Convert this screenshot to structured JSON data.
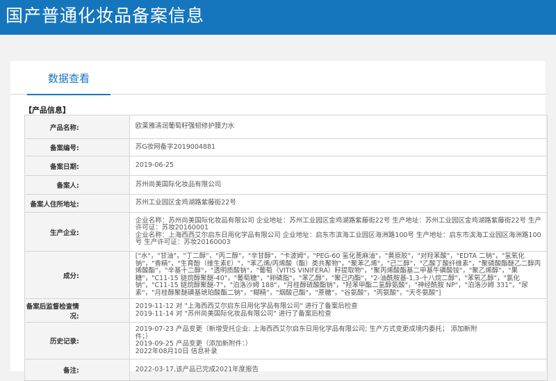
{
  "header": {
    "title": "国产普通化妆品备案信息"
  },
  "tabs": [
    {
      "label": "数据查看"
    }
  ],
  "section_title": "【产品信息】",
  "rows": {
    "product_name": {
      "label": "产品名称:",
      "value": "欧莱雅清润葡萄籽强韧修护膜力水"
    },
    "record_no": {
      "label": "备案编号:",
      "value": "苏G妆网备字2019004881"
    },
    "record_date": {
      "label": "备案日期:",
      "value": "2019-06-25"
    },
    "filer": {
      "label": "备案人:",
      "value": "苏州尚美国际化妆品有限公司"
    },
    "filer_address": {
      "label": "备案人住所地址:",
      "value": "苏州工业园区金鸡湖路紫藤街22号"
    },
    "manufacturer": {
      "label": "生产企业:",
      "lines": [
        "企业名称：苏州尚美国际化妆品有限公司 企业地址：苏州工业园区金鸡湖路紫藤街22号 生产地址：苏州工业园区金鸡湖路紫藤街22号 生产",
        "许可证：苏妆20160001",
        "企业名称：上海西西艾尔启东日用化学品有限公司 企业地址：启东市滨海工业园区海洲路100号 生产地址：启东市滨海工业园区海洲路100",
        "号 生产许可证：苏妆20160003"
      ]
    },
    "ingredients": {
      "label": "成分:",
      "lines": [
        "[\"水\"，\"甘油\"，\"丁二醇\"，\"丙二醇\"，\"辛甘醇\"，\"卡波姆\"，\"PEG-60 氢化蓖麻油\"，\"黄原胶\"，\"对羟苯酸\"，\"EDTA 二钠\"，\"氢氧化",
        "钠\"，\"香精\"，\"生育酚（维生素E）\"，\"苯乙烯/丙烯酸（酯）类共聚物\"，\"聚苯乙烯\"，\"己二醇\"，\"乙酸丁酸纤维素\"，\"聚磷酸酯醚乙二醇丙",
        "烯酸酯\"，\"辛基十二醇\"，\"透明质酸钠\"，\"葡萄（VITIS VINIFERA）籽提取物\"，\"聚丙烯酸酯基二甲基牛磺酸铵\"，\"聚乙烯醇\"，\"果",
        "糖\"，\"C11-15 链烷醇聚醚-40\"，\"葡萄糖\"，\"卵磷脂\"，\"苯乙醇\"，\"聚己内酯\"，\"2-油酰胺基-1,3-十八烷二醇\"，\"苯氧乙醇\"，\"氯化",
        "钠\"，\"C11-15 链烷醇聚醚-7\"，\"泊洛沙姆 188\"，\"月桂醇硫酸酯钠\"，\"羟苯甲酯二氢醇氨酸\"，\"神经酰胺 NP\"，\"泊洛沙姆 331\"，\"尿",
        "素\"，\"月桂醇聚醚磺基琥珀酸酯二钠\"，\"糊精\"，\"烟酸己酯\"，\"蔗糖\"，\"谷氨酸\"，\"丙氨酸\"，\"天冬氨酸\"]"
      ]
    },
    "post_inspection": {
      "label": "备案后监督检查情况:",
      "lines": [
        "2019-11-12 对 \"上海西西艾尔启东日用化学品有限公司\" 进行了备案后检查",
        "2019-11-14 对 \"苏州尚美国际化妆品有限公司\" 进行了备案后检查"
      ]
    },
    "history": {
      "label": "历史记录:",
      "lines": [
        "2019-07-23 产品变更（新增受托企业: 上海西西艾尔启东日用化学品有限公司; 生产方式变更成境内委托； 添加新附",
        "件；）",
        "2019-09-25 产品变更（添加新附件：）",
        "2022年08月10日 信息补录"
      ]
    },
    "remarks": {
      "label": "备注:",
      "value": "2022-03-17,该产品已完成2021年度报告"
    }
  }
}
